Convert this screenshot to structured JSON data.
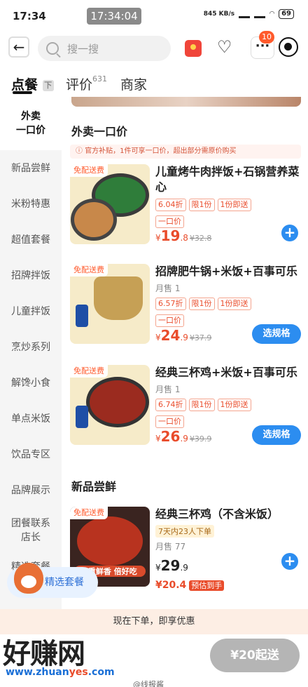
{
  "status_bar": {
    "time": "17:34",
    "center_time": "17:34:04",
    "net_speed": "845 KB/s",
    "battery": "69"
  },
  "header": {
    "search_placeholder": "搜一搜",
    "cart_badge": "10"
  },
  "tabs": [
    {
      "label": "点餐"
    },
    {
      "label": "评价",
      "count": "631"
    },
    {
      "label": "商家"
    }
  ],
  "sidebar": [
    "外卖\n一口价",
    "新品尝鲜",
    "米粉特惠",
    "超值套餐",
    "招牌拌饭",
    "儿童拌饭",
    "烹炒系列",
    "解馋小食",
    "单点米饭",
    "饮品专区",
    "品牌展示",
    "团餐联系\n店长",
    "精选套餐"
  ],
  "section1": {
    "title": "外卖一口价",
    "notice": "官方补贴，1件可享一口价，超出部分需原价购买"
  },
  "products": [
    {
      "tag": "免配送费",
      "name": "儿童烤牛肉拌饭+石锅营养菜心",
      "sold": "",
      "discount": "6.04折",
      "limit": "限1份",
      "instant": "1份即送",
      "one_price": "一口价",
      "price_symbol": "¥",
      "price_int": "19",
      "price_dec": ".8",
      "orig_price": "¥32.8",
      "action": "plus"
    },
    {
      "tag": "免配送费",
      "name": "招牌肥牛锅+米饭+百事可乐",
      "sold": "月售 1",
      "discount": "6.57折",
      "limit": "限1份",
      "instant": "1份即送",
      "one_price": "一口价",
      "price_symbol": "¥",
      "price_int": "24",
      "price_dec": ".9",
      "orig_price": "¥37.9",
      "action": "选规格"
    },
    {
      "tag": "免配送费",
      "name": "经典三杯鸡+米饭+百事可乐",
      "sold": "月售 1",
      "discount": "6.74折",
      "limit": "限1份",
      "instant": "1份即送",
      "one_price": "一口价",
      "price_symbol": "¥",
      "price_int": "26",
      "price_dec": ".9",
      "orig_price": "¥39.9",
      "action": "选规格"
    }
  ],
  "section2": {
    "title": "新品尝鲜"
  },
  "new_product": {
    "tag": "免配送费",
    "name": "经典三杯鸡（不含米饭）",
    "hot": "7天内23人下单",
    "sold": "月售 77",
    "price_symbol": "¥",
    "price_int": "29",
    "price_dec": ".9",
    "est_price": "¥20.4",
    "est_label": "预估到手",
    "thumb_text": "3重鲜香 倍好吃"
  },
  "floating": {
    "label": "精选套餐"
  },
  "promo_bar": "现在下单，即享优惠",
  "checkout": "¥20起送",
  "watermark": {
    "title": "好赚网",
    "url_a": "www.zhuan",
    "url_b": "yes",
    "url_c": ".com",
    "note": "@线报酱"
  },
  "colors": {
    "accent": "#2c8df0",
    "price": "#e94c2b"
  }
}
